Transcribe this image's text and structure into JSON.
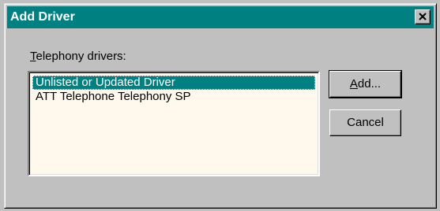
{
  "window": {
    "title": "Add Driver",
    "close_glyph": "close-icon"
  },
  "label": {
    "mnemonic": "T",
    "rest": "elephony drivers:"
  },
  "list": {
    "items": [
      "Unlisted or Updated Driver",
      "ATT Telephone Telephony SP"
    ],
    "selected_index": 0
  },
  "buttons": {
    "add_mnemonic": "A",
    "add_rest": "dd...",
    "cancel": "Cancel"
  },
  "colors": {
    "titlebar": "#008080",
    "face": "#c0c0c0",
    "list_background": "#fff8ec",
    "selection": "#008080"
  }
}
